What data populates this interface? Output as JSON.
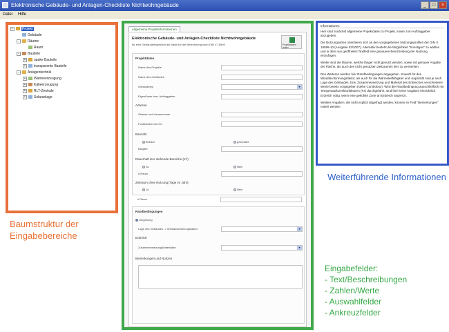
{
  "window": {
    "title": "Elektronische Gebäude- und Anlagen-Checkliste Nichtwohngebäude",
    "menu": [
      "Datei",
      "Hilfe"
    ]
  },
  "tree": {
    "items": [
      {
        "label": "Projekt",
        "indent": 0,
        "expander": "−",
        "selected": true
      },
      {
        "label": "Gebäude",
        "indent": 1,
        "expander": "",
        "selected": false
      },
      {
        "label": "Räume",
        "indent": 1,
        "expander": "−",
        "selected": false
      },
      {
        "label": "Raum",
        "indent": 2,
        "expander": "",
        "selected": false
      },
      {
        "label": "Bauteile",
        "indent": 1,
        "expander": "−",
        "selected": false
      },
      {
        "label": "opake Bauteile",
        "indent": 2,
        "expander": "+",
        "selected": false
      },
      {
        "label": "transparente Bauteile",
        "indent": 2,
        "expander": "+",
        "selected": false
      },
      {
        "label": "Anlagentechnik",
        "indent": 1,
        "expander": "−",
        "selected": false
      },
      {
        "label": "Wärmeerzeugung",
        "indent": 2,
        "expander": "+",
        "selected": false
      },
      {
        "label": "Kälteerzeugung",
        "indent": 2,
        "expander": "+",
        "selected": false
      },
      {
        "label": "RLT-Zentrale",
        "indent": 2,
        "expander": "+",
        "selected": false
      },
      {
        "label": "Solaranlage",
        "indent": 2,
        "expander": "+",
        "selected": false
      }
    ]
  },
  "form": {
    "tab_label": "Allgemeine Projektinformationen",
    "heading": "Elektronische Gebäude- und Anlagen-Checkliste Nichtwohngebäude",
    "subheading": "für eine Gebäudeinspektion als Basis für die Berechnung nach DIN V 18599",
    "project_button": {
      "line1": "Projektdaten",
      "line2": "laden"
    },
    "groups": {
      "project_title": "Projektdaten",
      "rows": [
        {
          "label": "Name des Projekts",
          "type": "text"
        },
        {
          "label": "Name des Gebäudes",
          "type": "text"
        },
        {
          "label": "Gebäudetyp",
          "type": "select"
        },
        {
          "label": "Eigentümer bzw. Auftraggeber",
          "type": "text"
        }
      ],
      "address_title": "Adresse",
      "address_rows": [
        {
          "label": "Strasse und Hausnummer",
          "type": "text"
        },
        {
          "label": "Postleitzahl und Ort",
          "type": "text"
        }
      ],
      "status_title": "Bauzahr",
      "status_options": [
        "Bebaut",
        "geschätzt"
      ],
      "status_row": "Baujahr",
      "usage_title": "Dauerhaft leer stehende Bereiche (m²)",
      "usage_options": [
        "Ja",
        "Nein"
      ],
      "usage_row": "# Raum",
      "period_title": "Zeitraum ohne Nutzung [Tage im Jahr]",
      "period_options": [
        "Ja",
        "Nein"
      ],
      "period_row": "# Raum",
      "boundary_title": "Randbedingungen",
      "boundary_option": "Umgebung",
      "boundary_row1": "Lage des Gebäudes -> Windabschirmungsfaktor",
      "boundary_sub": "Erdreich",
      "boundary_row2": "Zusammensetzung/Materialien",
      "notes_title": "Bemerkungen und Notizen"
    }
  },
  "info": {
    "header": "Informationen",
    "paragraphs": [
      "Hier sind zunächst allgemeine Projektdaten zu Projekt, sowie zum Auftraggeber anzugeben.",
      "Die Nutzungsarten orientieren sich an den vorgegebenen Nutzungsprofilen der DIN V 18599-10 (Ausgabe 02/2007). Alternativ besteht die Möglichkeit \"Sonstiges\" zu wählen und in dem nun geöffneten Textfeld eine genauere Beschreibung der Nutzung einzufügen.",
      "Weiter sind die Räume, welche länger nicht genutzt werden, sowie mit genauer Angabe der Fläche, als auch des nicht genutzten Zeitraumes hier zu vermerken.",
      "Des Weiteren werden hier Randbedingungen angegeben. Sowohl für den Windabschirmungsfaktor, als auch für die Wärmeleitfähigkeit und -kapazität sind je nach Lage des Gebäudes, bzw. Zusammensetzung und Material des Erdreiches verschiedene Werte bereits vorgegeben (siehe Combobox). Wird die Randbedingung ausschließlich mit Temperaturkorrekturfaktoren (Fx) durchgeführt, sind hier keine Angaben hinsichtlich Erdreich nötig, wenn eine gekühlte Zone an Erdreich angrenzt.",
      "Weitere Angaben, die nicht explizit abgefragt werden, können im Feld \"Bemerkungen\" notiert werden."
    ]
  },
  "annotations": {
    "tree": "Baumstruktur der Eingabebereiche",
    "info": "Weiterführende Informationen",
    "form_title": "Eingabefelder:",
    "form_items": [
      "- Text/Beschreibungen",
      "- Zahlen/Werte",
      "- Auswahlfelder",
      "- Ankreuzfelder"
    ]
  },
  "colors": {
    "tree_border": "#e8703a",
    "form_border": "#3fa84a",
    "info_border": "#3557c7"
  }
}
